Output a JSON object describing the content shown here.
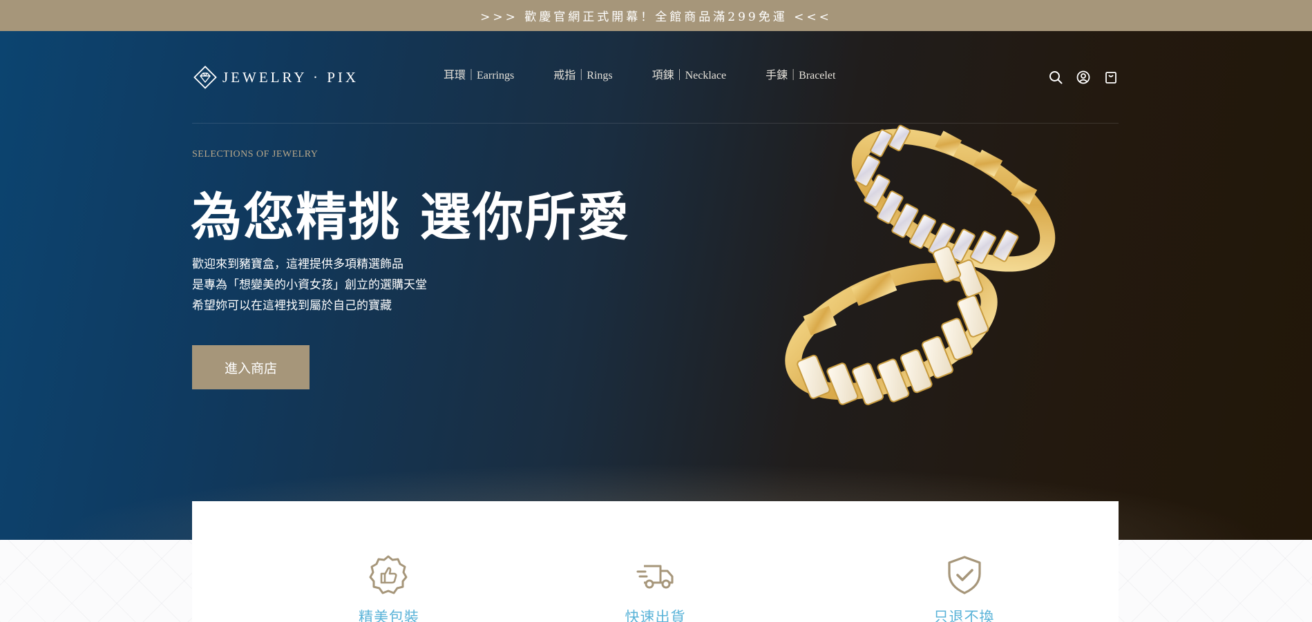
{
  "announcement": {
    "text": ">>> 歡慶官網正式開幕！全館商品滿299免運 <<<"
  },
  "brand": {
    "logo_text": "JEWELRY · PIX"
  },
  "nav": {
    "items": [
      {
        "label": "耳環｜Earrings"
      },
      {
        "label": "戒指｜Rings"
      },
      {
        "label": "項鍊｜Necklace"
      },
      {
        "label": "手鍊｜Bracelet"
      }
    ]
  },
  "header_icons": [
    "search-icon",
    "user-icon",
    "shopping-bag-icon"
  ],
  "hero": {
    "eyebrow": "SELECTIONS OF JEWELRY",
    "headline": "為您精挑 選你所愛",
    "description": [
      "歡迎來到豬寶盒，這裡提供多項精選飾品",
      "是專為「想變美的小資女孩」創立的選購天堂",
      "希望妳可以在這裡找到屬於自己的寶藏"
    ],
    "cta_label": "進入商店"
  },
  "features": [
    {
      "label": "精美包裝",
      "icon": "thumbs-up-badge-icon"
    },
    {
      "label": "快速出貨",
      "icon": "delivery-truck-icon"
    },
    {
      "label": "只退不換",
      "icon": "shield-check-icon"
    }
  ],
  "colors": {
    "accent_gold": "#a6967a",
    "feature_text": "#5ab3d8",
    "hero_left": "#0c4470",
    "hero_right": "#221709"
  }
}
